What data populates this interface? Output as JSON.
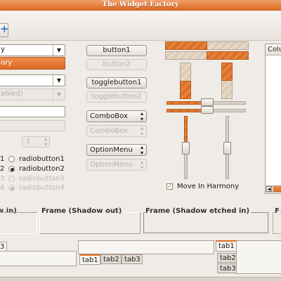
{
  "window": {
    "title": "The Widget Factory"
  },
  "toolbar": {
    "add_icon": "add-icon",
    "add_glyph": "+"
  },
  "column1": {
    "combo_entry_text": "y",
    "combo_popup_item": "ory",
    "combo2_text": "",
    "combo3_text": "abled)",
    "spin_value": "1",
    "radio_left_labels": [
      "1",
      "2",
      "3",
      "4"
    ],
    "radio_labels": [
      "radiobutton1",
      "radiobutton2",
      "radiobutton3",
      "radiobutton4"
    ]
  },
  "column2": {
    "button1": "button1",
    "button2": "button2",
    "togglebutton1": "togglebutton1",
    "togglebutton2": "togglebutton2",
    "combobox1": "ComboBox",
    "combobox2": "ComboBox",
    "optionmenu1": "OptionMenu",
    "optionmenu2": "OptionMenu"
  },
  "column3": {
    "progress_top_fraction": 0.5,
    "checkbox_label": "Move In Harmony",
    "checkbox_mark": "✓"
  },
  "column4": {
    "tree_header": "Colu"
  },
  "frames": {
    "frame_in": "w in)",
    "frame_out": "Frame (Shadow out)",
    "frame_etched_in": "Frame (Shadow etched in)",
    "frame_last": "F"
  },
  "tabs_bottom": {
    "left_tab": "3",
    "middle_tabs": [
      "tab1",
      "tab2",
      "tab3"
    ],
    "right_tabs": [
      "tab1",
      "tab2",
      "tab3"
    ]
  },
  "colors": {
    "accent": "#e06a22",
    "background": "#efebe7"
  }
}
